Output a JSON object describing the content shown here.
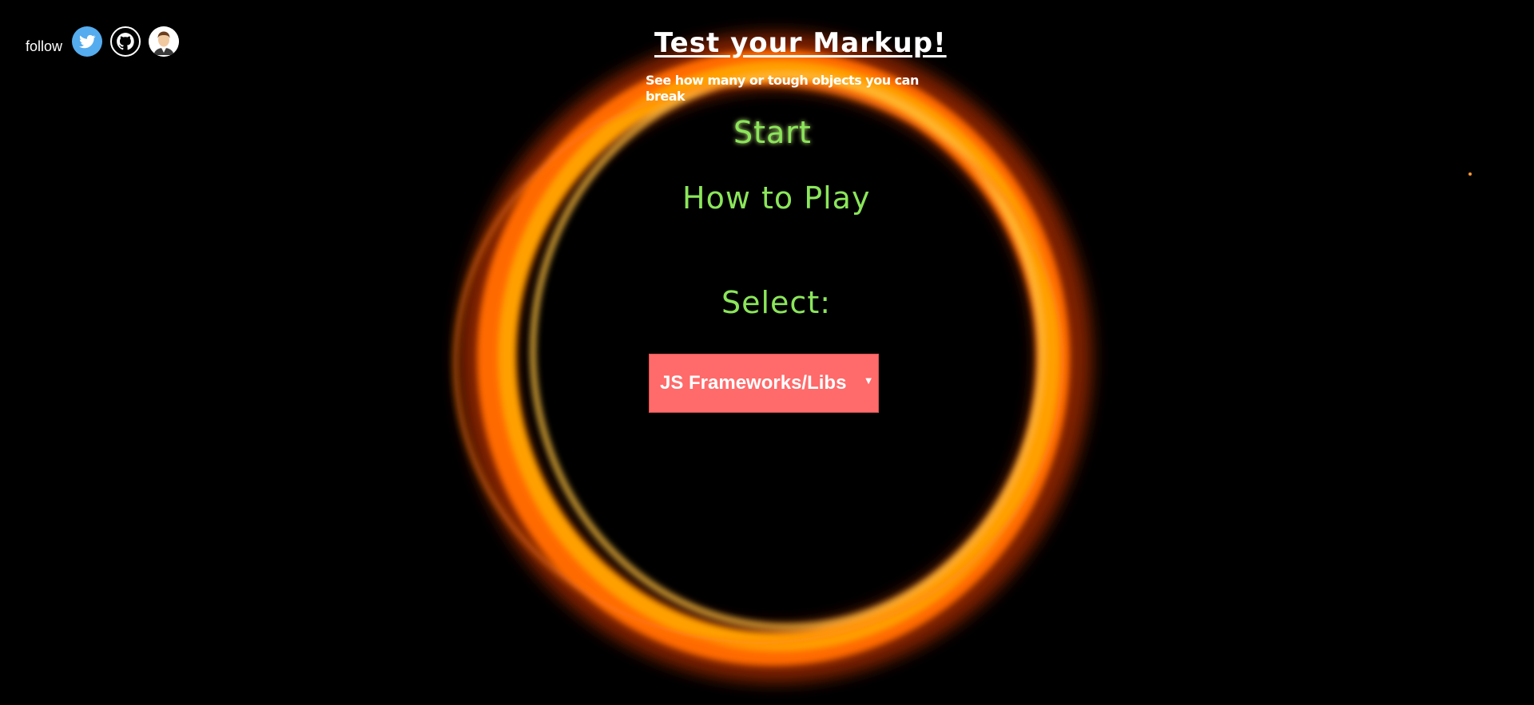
{
  "follow": {
    "label": "follow",
    "links": [
      {
        "name": "twitter-icon"
      },
      {
        "name": "github-icon"
      },
      {
        "name": "avatar-icon"
      }
    ]
  },
  "header": {
    "title": "Test your Markup!",
    "subtitle": "See how many or tough objects you can break"
  },
  "menu": {
    "start": "Start",
    "how_to_play": "How to Play",
    "select_label": "Select:"
  },
  "category_select": {
    "value": "JS Frameworks/Libs"
  },
  "colors": {
    "background": "#000000",
    "menu_text": "#8be65a",
    "dropdown_bg": "#ff6a6a",
    "twitter": "#55acee",
    "ring": "#ff8c00"
  }
}
